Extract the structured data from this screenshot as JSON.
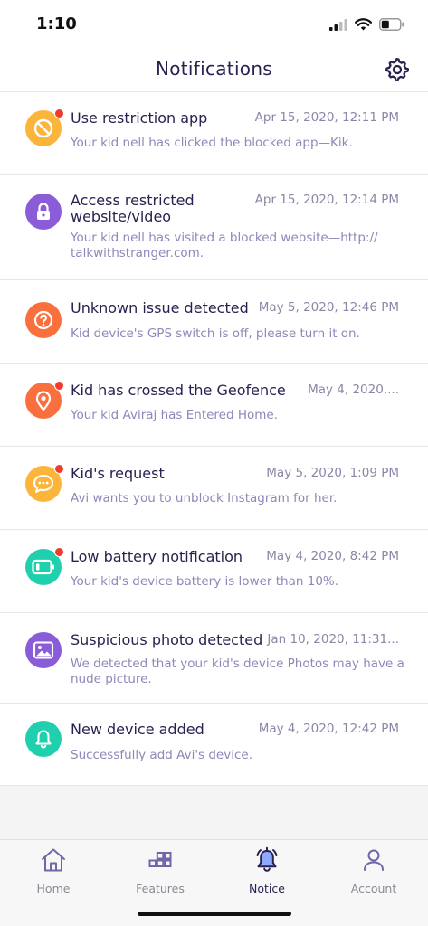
{
  "status_bar": {
    "time": "1:10"
  },
  "header": {
    "title": "Notifications",
    "settings_icon": "gear-icon"
  },
  "notifications": [
    {
      "title": "Use restriction app",
      "time": "Apr 15, 2020, 12:11 PM",
      "description": "Your kid nell has clicked the blocked app—Kik.",
      "icon": "block-icon",
      "color": "#fcb53b",
      "unread": true
    },
    {
      "title": "Access restricted website/video",
      "title_line1": "Access restricted",
      "title_line2": "website/video",
      "time": "Apr 15, 2020, 12:14 PM",
      "description": "Your kid nell has visited a blocked website—http:// talkwithstranger.com.",
      "icon": "lock-icon",
      "color": "#8a5cd8",
      "unread": false
    },
    {
      "title": "Unknown issue detected",
      "time": "May 5, 2020, 12:46 PM",
      "description": "Kid device's GPS switch is off, please turn it on.",
      "icon": "question-icon",
      "color": "#f9703e",
      "unread": false
    },
    {
      "title": "Kid has crossed the Geofence",
      "time": "May 4, 2020,...",
      "description": "Your kid Aviraj has Entered Home.",
      "icon": "location-pin-icon",
      "color": "#f9703e",
      "unread": true
    },
    {
      "title": "Kid's request",
      "time": "May 5, 2020, 1:09 PM",
      "description": "Avi wants you to unblock Instagram for her.",
      "icon": "chat-bubble-icon",
      "color": "#fcb53b",
      "unread": true
    },
    {
      "title": "Low battery notification",
      "time": "May 4, 2020, 8:42 PM",
      "description": "Your kid's device battery is lower than 10%.",
      "icon": "battery-icon",
      "color": "#20cfae",
      "unread": true
    },
    {
      "title": "Suspicious photo detected",
      "time": "Jan 10, 2020, 11:31...",
      "description": "We detected that your kid's device Photos may have a nude picture.",
      "icon": "photo-icon",
      "color": "#8a5cd8",
      "unread": false
    },
    {
      "title": "New device added",
      "time": "May 4, 2020, 12:42 PM",
      "description": "Successfully add Avi's device.",
      "icon": "bell-icon",
      "color": "#20cfae",
      "unread": false
    }
  ],
  "tab_bar": {
    "tabs": [
      {
        "label": "Home",
        "icon": "home-icon",
        "active": false
      },
      {
        "label": "Features",
        "icon": "features-icon",
        "active": false
      },
      {
        "label": "Notice",
        "icon": "notice-bell-icon",
        "active": true
      },
      {
        "label": "Account",
        "icon": "account-icon",
        "active": false
      }
    ]
  },
  "colors": {
    "accent": "#2b2150",
    "unread_dot": "#f03b2d",
    "text_secondary": "#9087b9"
  }
}
